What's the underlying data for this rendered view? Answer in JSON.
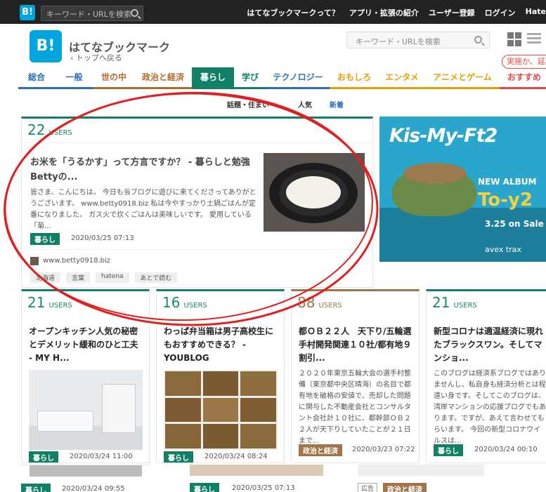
{
  "topbar": {
    "logo": "B!",
    "search_placeholder": "キーワード・URLを検索",
    "nav": [
      "はてなブックマークって？",
      "アプリ・拡張の紹介",
      "ユーザー登録",
      "ログイン",
      "Hate"
    ]
  },
  "header": {
    "logo": "B!",
    "title": "はてなブックマーク",
    "back_link": "‹ トップへ戻る",
    "search_placeholder": "キーワード・URLを検索",
    "badge": "実施か、延期"
  },
  "tabs": [
    {
      "label": "総合",
      "color": "#2d6fb7",
      "width": 52
    },
    {
      "label": "一般",
      "color": "#2d6fb7",
      "width": 55
    },
    {
      "label": "世の中",
      "color": "#b36b2c",
      "width": 58
    },
    {
      "label": "政治と経済",
      "color": "#b36b2c",
      "width": 82
    },
    {
      "label": "暮らし",
      "color": "#118066",
      "width": 60,
      "active": true
    },
    {
      "label": "学び",
      "color": "#118066",
      "width": 46
    },
    {
      "label": "テクノロジー",
      "color": "#2d6fb7",
      "width": 90
    },
    {
      "label": "おもしろ",
      "color": "#e4a000",
      "width": 70
    },
    {
      "label": "エンタメ",
      "color": "#e4a000",
      "width": 66
    },
    {
      "label": "アニメとゲーム",
      "color": "#e4a000",
      "width": 106
    },
    {
      "label": "おすすめ",
      "color": "#e84545",
      "width": 70
    }
  ],
  "subtabs": [
    "話題・住まい",
    "人気",
    "新着"
  ],
  "featured": {
    "users": "22",
    "users_label": "USERS",
    "title": "お米を「うるかす」って方言ですか？ - 暮らしと勉強　Bettyの...",
    "desc": "皆さま、こんにちは。 今日も当ブログに遊びに来てくださってありがとうございます。 www.betty0918.biz 私は今やすっかり土鍋ごはんが定番になりました。 ガス火で炊くごはんは美味しいです。 愛用している「菊...",
    "category": "暮らし",
    "date": "2020/03/25 07:13",
    "site": "www.betty0918.biz",
    "tags": [
      "北海道",
      "言葉",
      "hatena",
      "あとで読む"
    ]
  },
  "ad": {
    "artist": "Kis-My-Ft2",
    "line1": "NEW ALBUM",
    "album": "To-y2",
    "release": "3.25 on Sale",
    "label": "avex trax"
  },
  "cards": [
    {
      "users": "21",
      "title": "オープンキッチン人気の秘密とデメリット緩和のひと工夫 - MY H...",
      "category": "暮らし",
      "cat_color": "#118066",
      "date": "2020/03/24 11:00",
      "has_image": true
    },
    {
      "users": "16",
      "title": "わっぱ弁当箱は男子高校生にもおすすめできる？ - YOUBLOG",
      "category": "暮らし",
      "cat_color": "#118066",
      "date": "2020/03/24 08:24",
      "has_image": true
    },
    {
      "users": "88",
      "title": "都ＯＢ２２人　天下り/五輪選手村開発関連１０社/都有地９割引...",
      "desc": "２０２０年東京五輪大会の選手村整備（東京都中央区晴海）の名目で都有地を破格の安値で、売却した問題に関与した不動産会社とコンサルタント会社計１０社に、都幹部ＯＢ２２人が天下りしていたことが２１日まで...",
      "category": "政治と経済",
      "cat_color": "#a0754a",
      "date": "2020/03/23 07:22",
      "users_color": "#a0754a"
    },
    {
      "users": "21",
      "title": "新型コロナは適温経済に現れたブラックスワン。そしてマンショ...",
      "desc": "このブログは経済系ブログではありませんし、私自身も経済分析とは程遠い身です。そしてこのブログは、湾岸マンションの応援ブログでもあります。ですが、あえて言わせてもらいます。 今回の新型コロナウイルスは...",
      "category": "暮らし",
      "cat_color": "#118066",
      "date": "2020/03/24 00:10"
    }
  ],
  "bottom": [
    {
      "category": "暮らし",
      "date": "2020/03/24 09:55"
    },
    {
      "category": "暮らし",
      "date": "2020/03/25 07:13"
    },
    {
      "ad_label": "広告",
      "category": "政治と経済"
    }
  ]
}
